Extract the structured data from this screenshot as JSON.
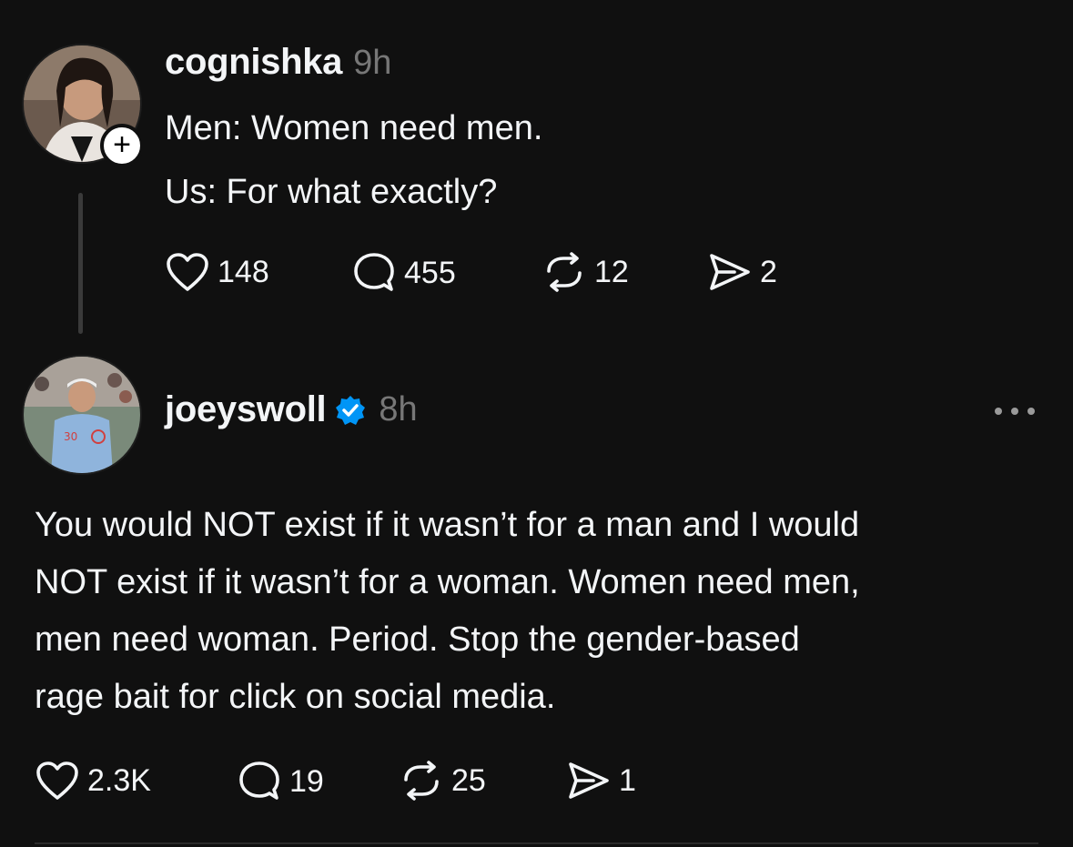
{
  "colors": {
    "background": "#101010",
    "text": "#f3f5f7",
    "muted": "#777777",
    "verified": "#0095f6",
    "thread_line": "#3a3a3a"
  },
  "posts": [
    {
      "username": "cognishka",
      "time": "9h",
      "avatar_icon": "profile-photo",
      "badge_icon": "plus-icon",
      "lines": [
        "Men: Women need men.",
        "Us: For what exactly?"
      ],
      "actions": {
        "likes": "148",
        "replies": "455",
        "reposts": "12",
        "shares": "2"
      }
    },
    {
      "username": "joeyswoll",
      "verified": true,
      "time": "8h",
      "avatar_icon": "profile-photo",
      "more_icon": "more-icon",
      "lines": [
        "You would NOT exist if it wasn’t for a man and I would",
        "NOT exist if it wasn’t for a woman. Women need men,",
        "men need woman. Period. Stop the gender-based",
        "rage bait for click on social media."
      ],
      "actions": {
        "likes": "2.3K",
        "replies": "19",
        "reposts": "25",
        "shares": "1"
      }
    }
  ]
}
